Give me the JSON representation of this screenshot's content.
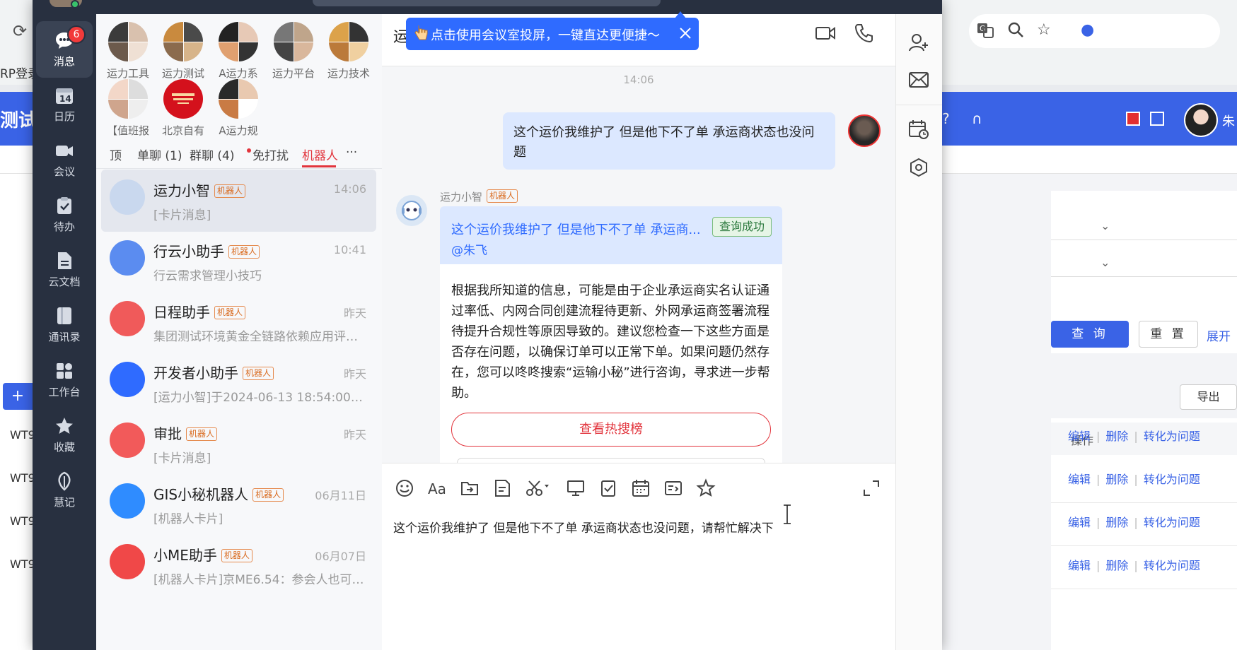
{
  "background": {
    "erp_text": "RP登录",
    "page_title": "测试",
    "user_initial": "朱",
    "query_button": "查 询",
    "reset_button": "重 置",
    "expand_link": "展开",
    "export_button": "导出",
    "add_button": "+",
    "column_operations": "操作",
    "row_prefix": "WT9",
    "row_actions": {
      "edit": "编辑",
      "delete": "删除",
      "convert": "转化为问题"
    }
  },
  "rail": {
    "badge_count": "6",
    "items": [
      {
        "label": "消息",
        "icon": "chat-bubble-icon"
      },
      {
        "label": "日历",
        "icon": "calendar-icon",
        "date": "14"
      },
      {
        "label": "会议",
        "icon": "video-camera-icon"
      },
      {
        "label": "待办",
        "icon": "clipboard-check-icon"
      },
      {
        "label": "云文档",
        "icon": "document-icon"
      },
      {
        "label": "通讯录",
        "icon": "contacts-book-icon"
      },
      {
        "label": "工作台",
        "icon": "app-grid-icon"
      },
      {
        "label": "收藏",
        "icon": "star-icon"
      },
      {
        "label": "慧记",
        "icon": "feather-icon"
      }
    ]
  },
  "pinned": [
    {
      "label": "运力工具"
    },
    {
      "label": "运力测试"
    },
    {
      "label": "A运力系"
    },
    {
      "label": "运力平台"
    },
    {
      "label": "运力技术"
    },
    {
      "label": "【值班报"
    },
    {
      "label": "北京自有"
    },
    {
      "label": "A运力规"
    }
  ],
  "tabs": [
    {
      "label": "顶"
    },
    {
      "label": "单聊 (1)"
    },
    {
      "label": "群聊 (4)"
    },
    {
      "label": "免打扰"
    },
    {
      "label": "机器人"
    },
    {
      "label": "···"
    }
  ],
  "bot_tag": "机器人",
  "conversations": [
    {
      "name": "运力小智",
      "time": "14:06",
      "preview": "[卡片消息]",
      "color": "#c9d8ee"
    },
    {
      "name": "行云小助手",
      "time": "10:41",
      "preview": "行云需求管理小技巧",
      "color": "#5b8cf0"
    },
    {
      "name": "日程助手",
      "time": "昨天",
      "preview": "集团测试环境黄金全链路依赖应用评估...",
      "color": "#f05a5a"
    },
    {
      "name": "开发者小助手",
      "time": "昨天",
      "preview": "[运力小智]于2024-06-13 18:54:00生产...",
      "color": "#2f6bff"
    },
    {
      "name": "审批",
      "time": "昨天",
      "preview": "[卡片消息]",
      "color": "#f25a5a"
    },
    {
      "name": "GIS小秘机器人",
      "time": "06月11日",
      "preview": "[机器人卡片]",
      "color": "#2f8cff"
    },
    {
      "name": "小ME助手",
      "time": "06月07日",
      "preview": "[机器人卡片]京ME6.54：参会人也可以...",
      "color": "#f04848"
    }
  ],
  "chat": {
    "title": "运",
    "banner": "点击使用会议室投屏，一键直达更便捷～",
    "time": "14:06",
    "my_message": "这个运价我维护了 但是他下不了单 承运商状态也没问题",
    "bot_name": "运力小智",
    "bot_quote": "这个运价我维护了 但是他下不了单 承运商...",
    "bot_mention": "@朱飞",
    "query_status": "查询成功",
    "bot_reply": "根据我所知道的信息，可能是由于企业承运商实名认证通过率低、内网合同创建流程待更新、外网承运商签署流程待提升合规性等原因导致的。建议您检查一下这些方面是否存在问题，以确保订单可以正常下单。如果问题仍然存在，您可以咚咚搜索“运输小秘”进行咨询，寻求进一步帮助。",
    "hot_button": "查看热搜榜"
  },
  "composer": {
    "text": "这个运价我维护了 但是他下不了单 承运商状态也没问题，请帮忙解决下"
  },
  "colors": {
    "accent": "#2f6bff",
    "danger": "#e2343c",
    "rail": "#283040"
  }
}
